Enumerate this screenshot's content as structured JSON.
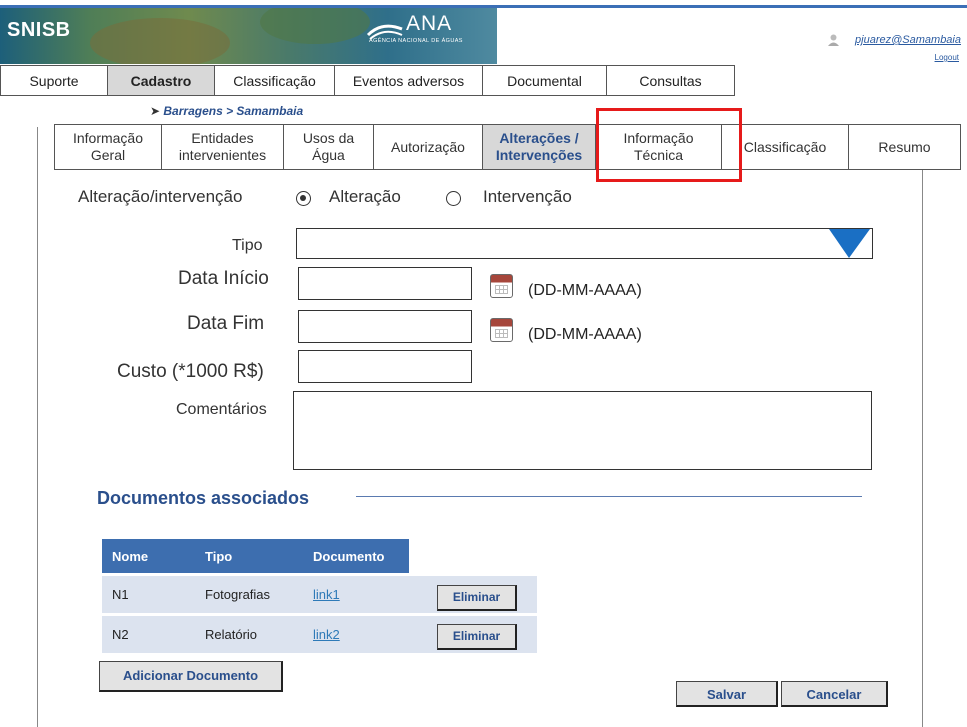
{
  "header": {
    "brand": "SNISB",
    "logo_text": "ANA",
    "logo_subtitle": "AGÊNCIA NACIONAL DE ÁGUAS",
    "user": "pjuarez@Samambaia",
    "logout": "Logout"
  },
  "main_tabs": [
    "Suporte",
    "Cadastro",
    "Classificação",
    "Eventos adversos",
    "Documental",
    "Consultas"
  ],
  "breadcrumb": "Barragens > Samambaia",
  "sub_tabs": {
    "t1a": "Informação",
    "t1b": "Geral",
    "t2a": "Entidades",
    "t2b": "intervenientes",
    "t3a": "Usos da",
    "t3b": "Água",
    "t4": "Autorização",
    "t5a": "Alterações /",
    "t5b": "Intervenções",
    "t6a": "Informação",
    "t6b": "Técnica",
    "t7": "Classificação",
    "t8": "Resumo"
  },
  "form": {
    "alteracao_label": "Alteração/intervenção",
    "opt_alteracao": "Alteração",
    "opt_intervencao": "Intervenção",
    "tipo": "Tipo",
    "data_inicio": "Data Início",
    "data_fim": "Data Fim",
    "date_format_1": "(DD-MM-AAAA)",
    "date_format_2": "(DD-MM-AAAA)",
    "custo": "Custo (*1000 R$)",
    "comentarios": "Comentários"
  },
  "documentos": {
    "title": "Documentos associados",
    "headers": [
      "Nome",
      "Tipo",
      "Documento"
    ],
    "rows": [
      {
        "nome": "N1",
        "tipo": "Fotografias",
        "doc": "link1",
        "action": "Eliminar"
      },
      {
        "nome": "N2",
        "tipo": "Relatório",
        "doc": "link2",
        "action": "Eliminar"
      }
    ],
    "add": "Adicionar Documento"
  },
  "actions": {
    "save": "Salvar",
    "cancel": "Cancelar"
  },
  "colors": {
    "accent": "#3d6eaf",
    "highlight": "#e61a1a",
    "row_bg": "#dce3ef"
  }
}
